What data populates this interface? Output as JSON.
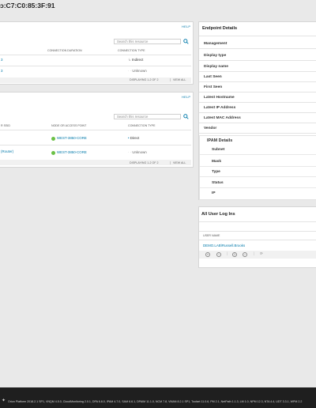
{
  "page": {
    "title": "ɔ:C7:C0:85:3F:91"
  },
  "connections_panel": {
    "help": "HELP",
    "search_placeholder": "Search this resource",
    "headers": [
      "CONNECTION DURATION",
      "CONNECTION TYPE"
    ],
    "rows": [
      {
        "name": "3",
        "type": "Indirect"
      },
      {
        "name": "3",
        "type": "Unknown"
      }
    ],
    "footer": "DISPLAYING 1-2 OF 2",
    "view_all": "VIEW ALL"
  },
  "access_panel": {
    "help": "HELP",
    "search_placeholder": "Search this resource",
    "headers": [
      "R SSID",
      "NODE OR ACCESS POINT",
      "CONNECTION TYPE"
    ],
    "rows": [
      {
        "name": "",
        "node": "WEST-3850-CORE",
        "type": "Direct"
      },
      {
        "name": "(Router)",
        "node": "WEST-3850-CORE",
        "type": "Unknown"
      }
    ],
    "footer": "DISPLAYING 1-2 OF 2",
    "view_all": "VIEW ALL"
  },
  "endpoint_details": {
    "title": "Endpoint Details",
    "rows": [
      "Management",
      "Display type",
      "Display name",
      "Last Seen",
      "First Seen",
      "Latest Hostname",
      "Latest IP Address",
      "Latest MAC Address",
      "Vendor"
    ],
    "ipam": {
      "title": "IPAM Details",
      "rows": [
        "Subnet",
        "Mask",
        "Type",
        "Status",
        "IP"
      ]
    }
  },
  "user_logins": {
    "title": "All User Log Ins",
    "header": "USER NAME",
    "user": "DEMO.LAB\\Russell.Brooks"
  },
  "footer": {
    "text": "Orion Platform 2018.2.1 SP1, VNQM 4.5.0, CloudMonitoring 2.0.1, DPA 6.8.0, IPAM 4.7.0, SAM 6.6.1, DPAIM 11.1.0, NCM 7.8, VMAN 8.2.1 SP1, Toolset 11.0.6, PM 2.1, NetPath 1.1.3, LM 1.0, NPM 12.3, NTA 4.4, UDT 3.3.1, WPM 2.2"
  },
  "colors": {
    "accent": "#0079aa",
    "status_green": "#6bc046",
    "footer_bg": "#1f1f1f"
  }
}
